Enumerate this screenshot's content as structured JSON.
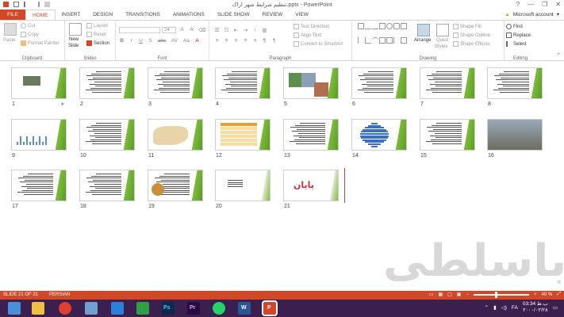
{
  "window": {
    "title": "تنظیم شرایط شهر اراک.pptx - PowerPoint",
    "controls": [
      "?",
      "—",
      "❐",
      "✕"
    ]
  },
  "tabs": {
    "file": "FILE",
    "items": [
      "HOME",
      "INSERT",
      "DESIGN",
      "TRANSITIONS",
      "ANIMATIONS",
      "SLIDE SHOW",
      "REVIEW",
      "VIEW"
    ],
    "active": "HOME",
    "account": "Microsoft account"
  },
  "ribbon": {
    "clipboard": {
      "label": "Clipboard",
      "paste": "Paste",
      "cut": "Cut",
      "copy": "Copy",
      "format_painter": "Format Painter"
    },
    "slides": {
      "label": "Slides",
      "new_slide": "New",
      "new_slide_2": "Slide",
      "layout": "Layout",
      "reset": "Reset",
      "section": "Section"
    },
    "font": {
      "label": "Font",
      "size": "24",
      "buttons": [
        "B",
        "I",
        "U",
        "S",
        "abc",
        "AV",
        "Aa",
        "A"
      ]
    },
    "paragraph": {
      "label": "Paragraph",
      "text_direction": "Text Direction",
      "align_text": "Align Text",
      "convert_smartart": "Convert to SmartArt"
    },
    "drawing": {
      "label": "Drawing",
      "arrange": "Arrange",
      "quick_styles": "Quick",
      "quick_styles_2": "Styles",
      "shape_fill": "Shape Fill",
      "shape_outline": "Shape Outline",
      "shape_effects": "Shape Effects"
    },
    "editing": {
      "label": "Editing",
      "find": "Find",
      "replace": "Replace",
      "select": "Select"
    }
  },
  "slides": [
    {
      "num": "1",
      "kind": "title"
    },
    {
      "num": "2",
      "kind": "text"
    },
    {
      "num": "3",
      "kind": "text"
    },
    {
      "num": "4",
      "kind": "text"
    },
    {
      "num": "5",
      "kind": "photos"
    },
    {
      "num": "6",
      "kind": "text"
    },
    {
      "num": "7",
      "kind": "text"
    },
    {
      "num": "8",
      "kind": "text"
    },
    {
      "num": "9",
      "kind": "chart"
    },
    {
      "num": "10",
      "kind": "text"
    },
    {
      "num": "11",
      "kind": "map"
    },
    {
      "num": "12",
      "kind": "table"
    },
    {
      "num": "13",
      "kind": "text"
    },
    {
      "num": "14",
      "kind": "pyramid"
    },
    {
      "num": "15",
      "kind": "text"
    },
    {
      "num": "16",
      "kind": "photo"
    },
    {
      "num": "17",
      "kind": "text"
    },
    {
      "num": "18",
      "kind": "text"
    },
    {
      "num": "19",
      "kind": "image-text"
    },
    {
      "num": "20",
      "kind": "refs"
    },
    {
      "num": "21",
      "kind": "end",
      "text": "پایان"
    }
  ],
  "watermark": "باسلطی",
  "status": {
    "slide_info": "SLIDE 21 OF 21",
    "language": "PERSIAN",
    "zoom": "40 %",
    "zoom_level": 0.4
  },
  "taskbar": {
    "word_label": "W",
    "ppt_label": "P",
    "ps_label": "Ps",
    "pr_label": "Pr",
    "lang": "FA",
    "time": "03:34 ب.ظ",
    "date": "۲۰۰۰/۰۲/۲۸"
  },
  "colors": {
    "accent": "#D24726",
    "slide_green": "#7cbd3a",
    "taskbar": "#3b1f4f"
  }
}
